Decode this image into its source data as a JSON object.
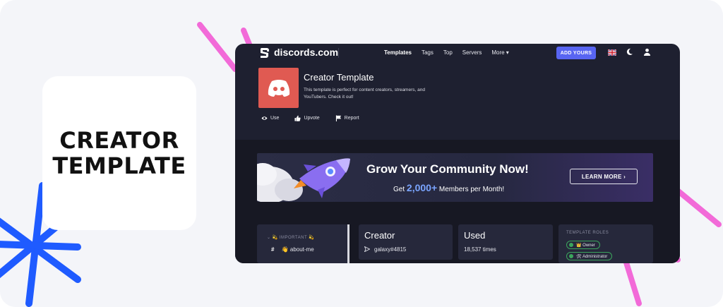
{
  "poster": {
    "title_line1": "CREATOR",
    "title_line2": "TEMPLATE"
  },
  "site": {
    "logo_text": "discords.com",
    "nav": [
      "Templates",
      "Tags",
      "Top",
      "Servers",
      "More ▾"
    ],
    "active_nav": "Templates",
    "add_button": "ADD YOURS",
    "accent_color": "#5865f2"
  },
  "template": {
    "title": "Creator Template",
    "description": "This template is perfect for content creators, streamers, and YouTubers. Check it out!",
    "icon_color": "#e05a52",
    "actions": {
      "use": "Use",
      "upvote": "Upvote",
      "report": "Report"
    }
  },
  "banner": {
    "headline": "Grow Your Community Now!",
    "sub_prefix": "Get",
    "sub_highlight": "2,000+",
    "sub_suffix": "Members per Month!",
    "button": "LEARN MORE  ›"
  },
  "channels": {
    "category": "⌄  💫 IMPORTANT 💫",
    "items": [
      {
        "hash": "#",
        "name": "👋 about-me"
      }
    ]
  },
  "info_cards": {
    "creator_heading": "Creator",
    "creator_value": "galaxy#4815",
    "used_heading": "Used",
    "used_value": "18,537 times"
  },
  "roles": {
    "heading": "TEMPLATE ROLES",
    "items": [
      "👑 Owner",
      "🛠 Administrator"
    ]
  }
}
